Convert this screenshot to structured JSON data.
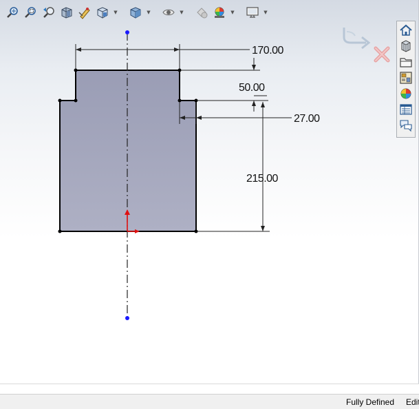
{
  "toolbar": {
    "icons": [
      "zoom-to-fit-icon",
      "zoom-to-area-icon",
      "previous-view-icon",
      "section-view-icon",
      "dynamic-annotation-icon",
      "view-orientation-icon",
      "display-style-icon",
      "hide-show-items-icon",
      "edit-appearance-icon",
      "apply-scene-icon",
      "view-settings-icon"
    ]
  },
  "sketch": {
    "dimensions": {
      "top_width": "170.00",
      "step_height": "50.00",
      "step_offset": "27.00",
      "lower_height": "215.00"
    },
    "colors": {
      "profile_fill": "#a3a6bd",
      "profile_edge": "#000000",
      "centerline": "#111111",
      "endpoint": "#0000ff",
      "origin": "#ff0000"
    }
  },
  "taskpane": {
    "icons": [
      "home-icon",
      "design-library-icon",
      "file-explorer-icon",
      "view-palette-icon",
      "appearances-icon",
      "custom-properties-icon",
      "forum-icon"
    ]
  },
  "confirm_corner": {
    "icons": [
      "ok-icon",
      "cancel-icon"
    ]
  },
  "statusbar": {
    "status": "Fully Defined",
    "mode": "Edit"
  }
}
